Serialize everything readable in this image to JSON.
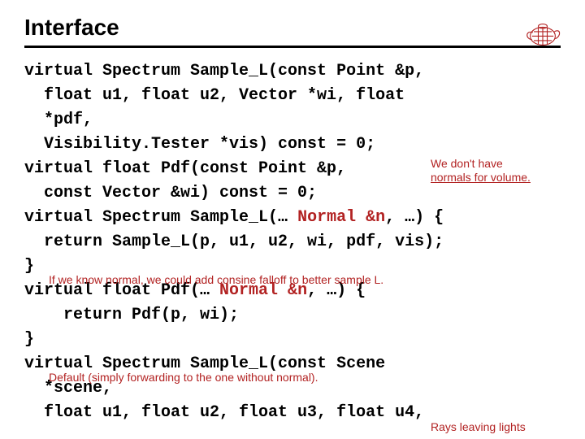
{
  "title": "Interface",
  "code_lines": [
    "virtual Spectrum Sample_L(const Point &p,",
    "  float u1, float u2, Vector *wi, float",
    "  *pdf,",
    "  Visibility.Tester *vis) const = 0;",
    "virtual float Pdf(const Point &p,",
    "  const Vector &wi) const = 0;",
    "virtual Spectrum Sample_L(… Normal &n, …) {",
    "  return Sample_L(p, u1, u2, wi, pdf, vis);",
    "}",
    "virtual float Pdf(… Normal &n, …) {",
    "    return Pdf(p, wi);",
    "}",
    "virtual Spectrum Sample_L(const Scene",
    "  *scene,",
    "  float u1, float u2, float u3, float u4,"
  ],
  "annotations": {
    "a1_l1": "We don't have",
    "a1_l2": "normals for volume.",
    "a2": "If we know normal, we could add consine falloff to better sample L.",
    "a3": "Default (simply forwarding to the one without normal).",
    "a4": "Rays leaving lights"
  }
}
